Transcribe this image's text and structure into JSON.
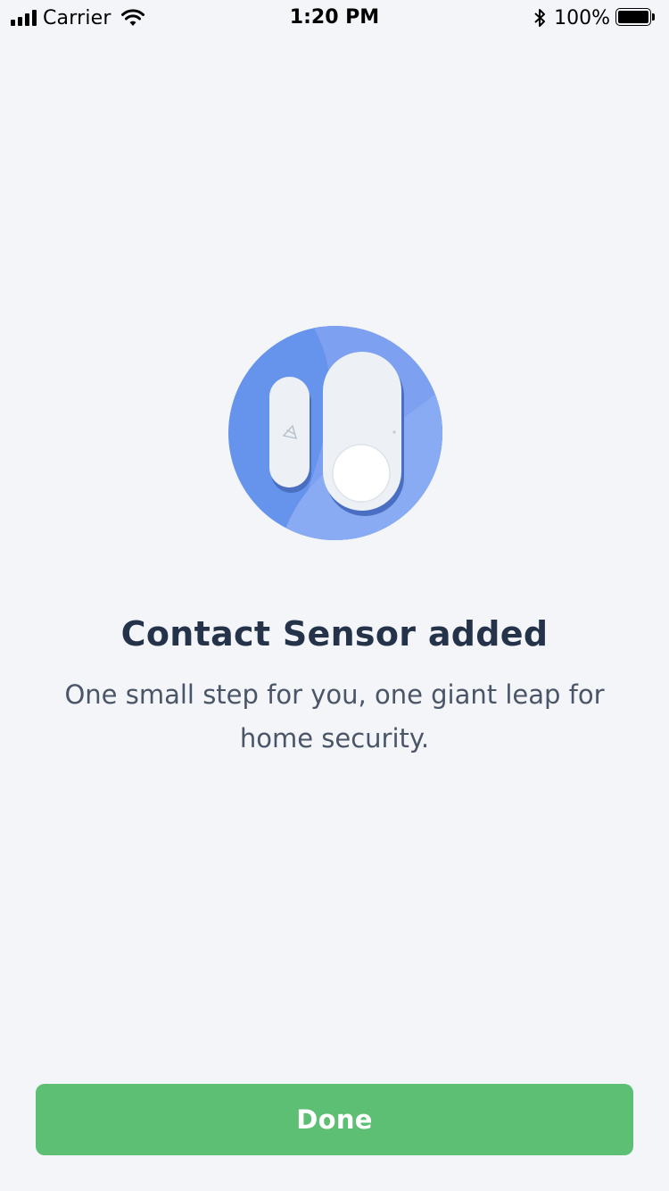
{
  "status_bar": {
    "carrier": "Carrier",
    "time": "1:20 PM",
    "battery_percent": "100%",
    "signal_icon": "cellular-signal-icon",
    "wifi_icon": "wifi-icon",
    "bluetooth_icon": "bluetooth-icon",
    "battery_icon": "battery-icon",
    "battery_level": 1.0
  },
  "illustration": {
    "icon": "contact-sensor-illustration",
    "colors": {
      "circle_dark": "#5b8fe9",
      "circle_light": "#86aaf3",
      "device_body": "#eef2f6",
      "device_shadow": "#4368b8"
    }
  },
  "main": {
    "title": "Contact Sensor added",
    "subtitle": "One small step for you, one giant leap for home security."
  },
  "footer": {
    "done_label": "Done",
    "done_color": "#5cbf74"
  }
}
